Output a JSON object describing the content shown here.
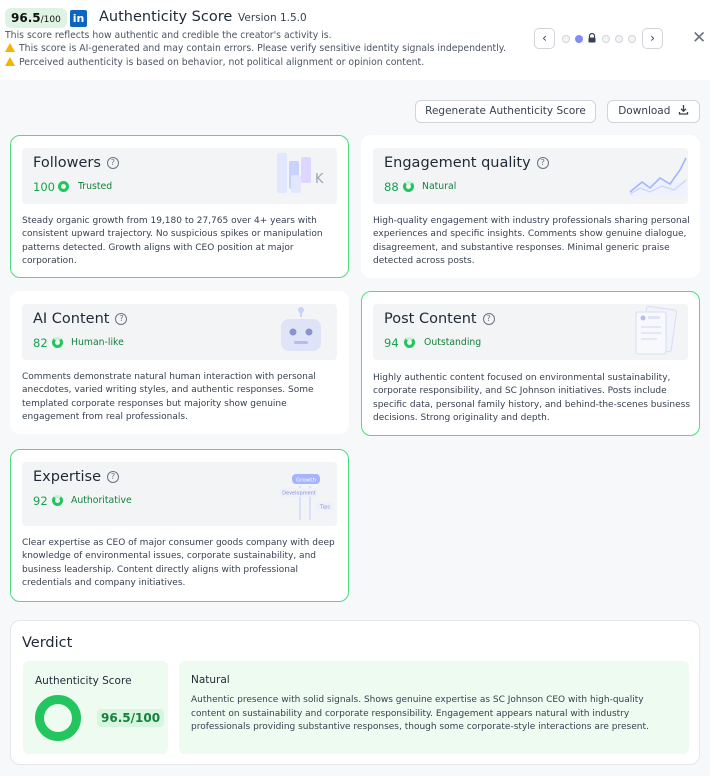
{
  "header": {
    "score": "96.5",
    "score_max": "/100",
    "network_logo": "in",
    "title": "Authenticity Score",
    "version": "Version 1.5.0",
    "subtitle": "This score reflects how authentic and credible the creator's activity is.",
    "warning1": "This score is AI-generated and may contain errors. Please verify sensitive identity signals independently.",
    "warning2": "Perceived authenticity is based on behavior, not political alignment or opinion content.",
    "prev_icon": "‹",
    "next_icon": "›",
    "close_icon": "✕",
    "warning_color": "#f4b400"
  },
  "toolbar": {
    "regenerate_label": "Regenerate Authenticity Score",
    "download_label": "Download"
  },
  "cards": {
    "followers": {
      "title": "Followers",
      "score": "100",
      "label": "Trusted",
      "illus_letter": "K",
      "description": "Steady organic growth from 19,180 to 27,765 over 4+ years with consistent upward trajectory. No suspicious spikes or manipulation patterns detected. Growth aligns with CEO position at major corporation."
    },
    "engagement": {
      "title": "Engagement quality",
      "score": "88",
      "label": "Natural",
      "description": "High-quality engagement with industry professionals sharing personal experiences and specific insights. Comments show genuine dialogue, disagreement, and substantive responses. Minimal generic praise detected across posts."
    },
    "ai_content": {
      "title": "AI Content",
      "score": "82",
      "label": "Human-like",
      "description": "Comments demonstrate natural human interaction with personal anecdotes, varied writing styles, and authentic responses. Some templated corporate responses but majority show genuine engagement from real professionals."
    },
    "post_content": {
      "title": "Post Content",
      "score": "94",
      "label": "Outstanding",
      "description": "Highly authentic content focused on environmental sustainability, corporate responsibility, and SC Johnson initiatives. Posts include specific data, personal family history, and behind-the-scenes business decisions. Strong originality and depth."
    },
    "expertise": {
      "title": "Expertise",
      "score": "92",
      "label": "Authoritative",
      "tag_growth": "Growth",
      "tag_development": "Development",
      "tag_tips": "Tips",
      "description": "Clear expertise as CEO of major consumer goods company with deep knowledge of environmental issues, corporate sustainability, and business leadership. Content directly aligns with professional credentials and company initiatives."
    }
  },
  "verdict": {
    "title": "Verdict",
    "score_label": "Authenticity Score",
    "score_value": "96.5/100",
    "verdict_label": "Natural",
    "verdict_text": "Authentic presence with solid signals. Shows genuine expertise as SC Johnson CEO with high-quality content on sustainability and corporate responsibility. Engagement appears natural with industry professionals providing substantive responses, though some corporate-style interactions are present."
  },
  "colors": {
    "accent_green": "#22c55e",
    "score_text_green": "#16a34a",
    "active_dot": "#818cf8",
    "linkedin_blue": "#0a66c2"
  }
}
